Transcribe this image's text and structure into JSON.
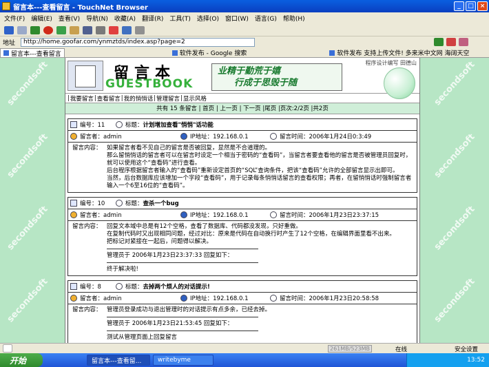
{
  "window": {
    "title": "留言本---查看留言 - TouchNet Browser",
    "btn_min": "_",
    "btn_max": "□",
    "btn_close": "×"
  },
  "menu": [
    "文件(F)",
    "编辑(E)",
    "查看(V)",
    "导航(N)",
    "收藏(A)",
    "翻译(R)",
    "工具(T)",
    "选择(O)",
    "窗口(W)",
    "语言(G)",
    "帮助(H)"
  ],
  "address": {
    "label": "地址",
    "url": "http://home.goofar.com/ynmztds/index.asp?page=2"
  },
  "tabs": [
    {
      "label": "留言本---查看留言",
      "active": true
    },
    {
      "label": "软件发布 - Google 搜索",
      "active": false
    },
    {
      "label": "软件发布 支持上传文件! 多来米中文网 海阔天空",
      "active": false
    }
  ],
  "watermark": "secondsoft",
  "page": {
    "logo_cn": "留言本",
    "logo_en": "GUESTBOOK",
    "motto_line1": "业精于勤荒于嬉",
    "motto_line2": "行成于思毁于随",
    "designer": "程序设计编写  田德山",
    "nav": [
      "我要留言",
      "查看留言",
      "我的悄悄话",
      "管理留言",
      "显示风格"
    ],
    "pager": "共有 15 条留言 | 首页 | 上一页 | 下一页 |尾页 |页次:2/2页 |共2页"
  },
  "entries": [
    {
      "number_label": "编号：11",
      "title_label": "标题：",
      "title": "计划增加查看\"悄悄\"话功能",
      "author_label": "留言者：admin",
      "ip_label": "IP地址：192.168.0.1",
      "time_label": "留言时间：2006年1月24日0:3:49",
      "content_label": "留言内容：",
      "content": [
        "如果留言者看不见自己的留言是否被回复，显然是不合道理的。",
        "那么留悄悄话的留言者可以在留言时设定一个相当于密码的“查看码”，当留言者要查看他的留言是否被管理员回复时，就可以使用这个“查看码”进行查看。",
        "后台程序根据留言者输入的“查看码”重新设定首页的“SQL”查询条件，把该“查看码”允许的全部留言显示出即可。",
        "当然，后台数据库应该增加一个字段“查看码”，用于记录每条悄悄话留言的查看权限；再者，在留悄悄话时强制留言者输入一个6至16位的“查看码”。"
      ],
      "reply": null,
      "reply_text": null
    },
    {
      "number_label": "编号：10",
      "title_label": "标题：",
      "title": "查杀一个bug",
      "author_label": "留言者：admin",
      "ip_label": "IP地址：192.168.0.1",
      "time_label": "留言时间：2006年1月23日23:37:15",
      "content_label": "留言内容：",
      "content": [
        "回复文本域中总是有12个空格，查看了数据库、代码都没发现，只好重做。",
        "在复制代码时又出现相同问题，经过对比：原来是代码在自动换行时产生了12个空格，在编辑界面里看不出来。",
        "把标记对紧接在一起后，问题得以解决。"
      ],
      "reply": "管理员于 2006年1月23日23:37:33 回复如下：",
      "reply_text": "终于解决啦!"
    },
    {
      "number_label": "编号：8",
      "title_label": "标题：",
      "title": "去掉两个烦人的对话提示!",
      "author_label": "留言者：admin",
      "ip_label": "IP地址：192.168.0.1",
      "time_label": "留言时间：2006年1月23日20:58:58",
      "content_label": "留言内容：",
      "content": [
        "管理员登录成功与退出管理时的对话提示有点多余，已经去掉。"
      ],
      "reply": "管理员于 2006年1月23日21:53:45 回复如下：",
      "reply_text": "测试从管理页面上回复留言"
    }
  ],
  "status": {
    "memory": "261MB/523MB",
    "network": "在线",
    "security": "安全设置"
  },
  "taskbar": {
    "start": "开始",
    "tasks": [
      {
        "label": "留言本---查看留...",
        "active": true
      },
      {
        "label": "writebyme",
        "active": false
      }
    ],
    "clock": "13:52"
  }
}
